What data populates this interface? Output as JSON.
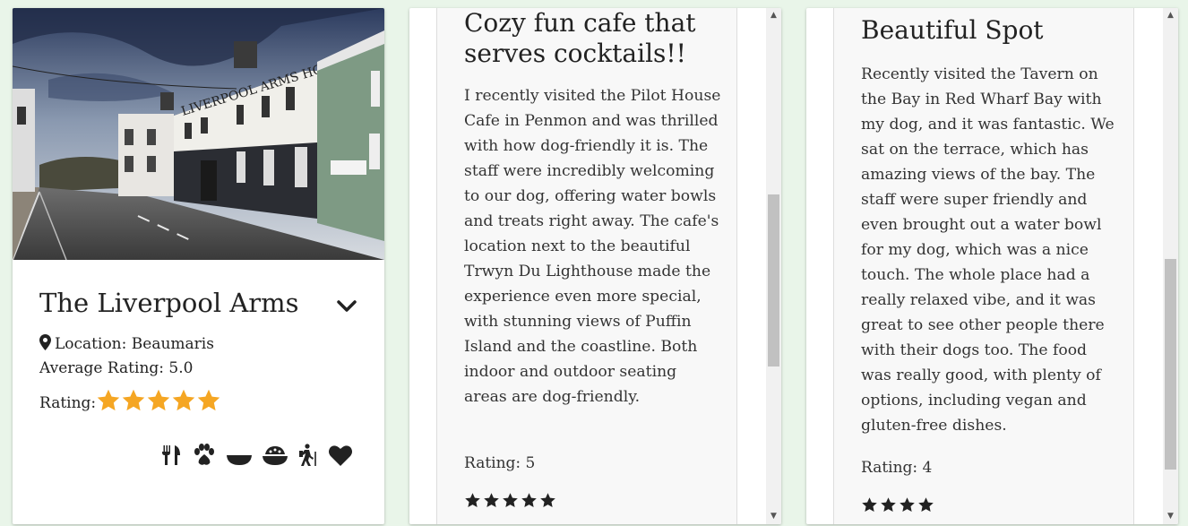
{
  "cards": {
    "venue": {
      "name": "The Liverpool Arms",
      "location_label": "Location: Beaumaris",
      "average_rating": "Average Rating: 5.0",
      "rating_label": "Rating:",
      "stars": 5,
      "amenities": [
        "food-icon",
        "paw-icon",
        "water-bowl-icon",
        "food-bowl-icon",
        "hiking-icon",
        "heart-icon"
      ],
      "star_color": "#f5a623"
    },
    "review1": {
      "title": "Cozy fun cafe that serves cocktails!!",
      "body": "I recently visited the Pilot House Cafe in Penmon and was thrilled with how dog-friendly it is. The staff were incredibly welcoming to our dog, offering water bowls and treats right away. The cafe's location next to the beautiful Trwyn Du Lighthouse made the experience even more special, with stunning views of Puffin Island and the coastline. Both indoor and outdoor seating areas are dog-friendly.",
      "rating_label": "Rating: 5",
      "stars": 5
    },
    "review2": {
      "title": "Beautiful Spot",
      "body": "Recently visited the Tavern on the Bay in Red Wharf Bay with my dog, and it was fantastic. We sat on the terrace, which has amazing views of the bay. The staff were super friendly and even brought out a water bowl for my dog, which was a nice touch. The whole place had a really relaxed vibe, and it was great to see other people there with their dogs too. The food was really good, with plenty of options, including vegan and gluten-free dishes.",
      "rating_label": "Rating: 4",
      "stars": 4
    }
  },
  "photo_sign": "LIVERPOOL ARMS HOTEL"
}
